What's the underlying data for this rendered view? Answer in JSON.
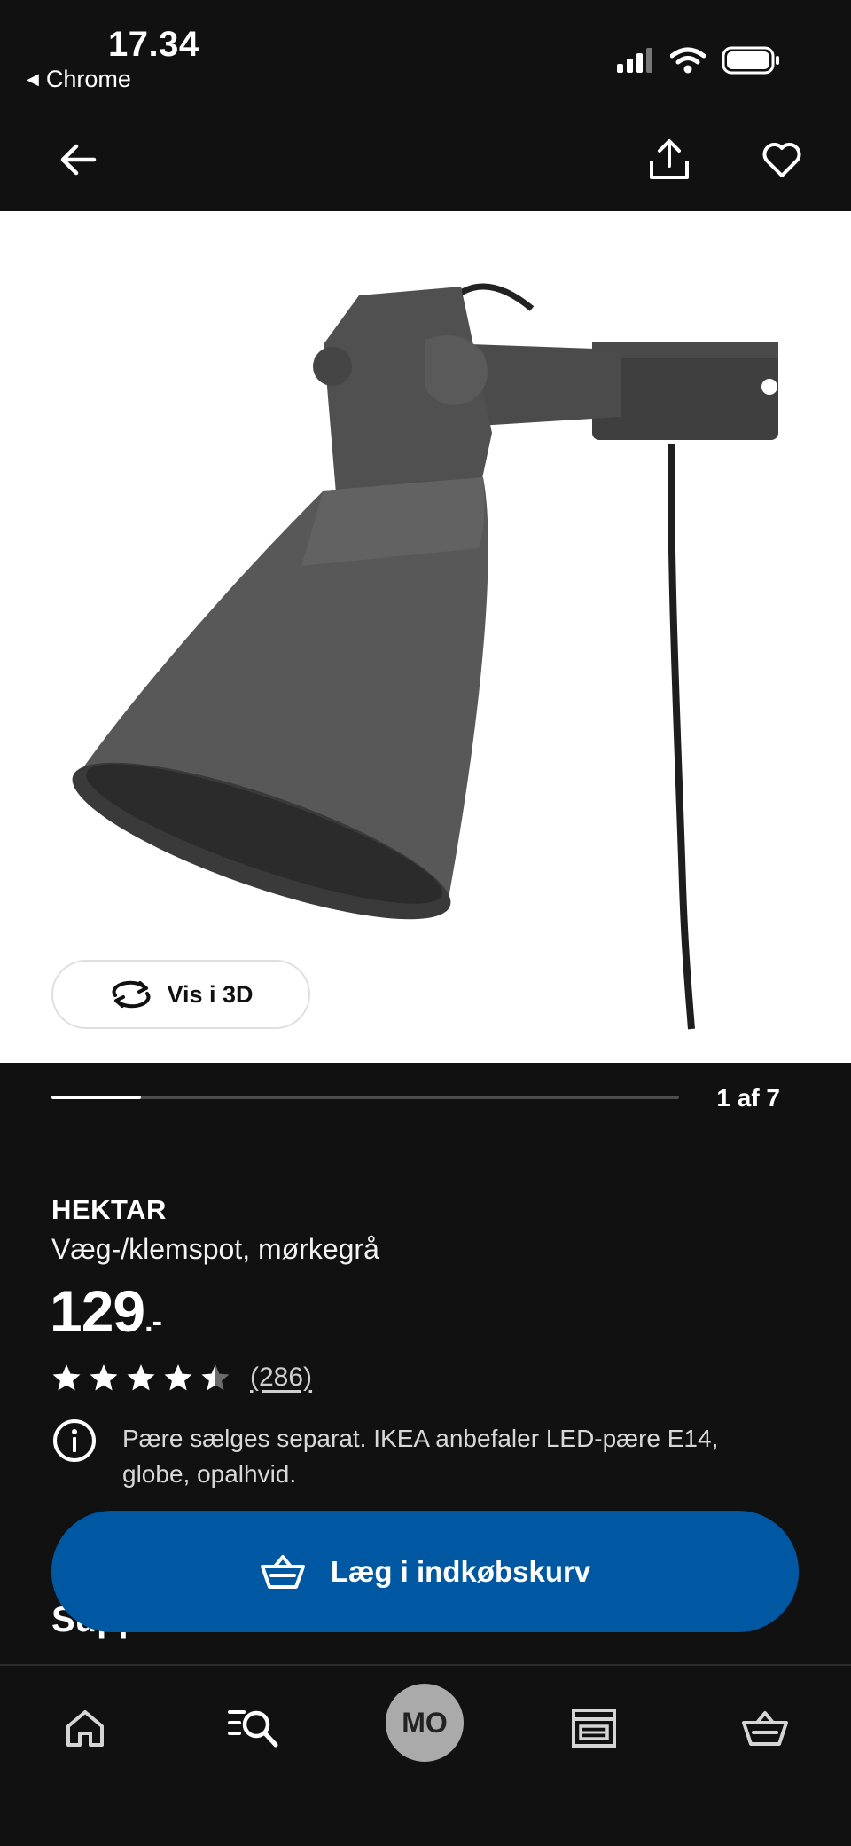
{
  "status_bar": {
    "time": "17.34",
    "back_app": "Chrome"
  },
  "icons": {
    "back": "arrow-left-icon",
    "share": "share-icon",
    "favorite": "heart-icon",
    "rotate": "rotate-3d-icon",
    "info": "info-icon",
    "basket": "basket-icon",
    "home": "home-icon",
    "search": "search-icon",
    "store": "store-icon"
  },
  "gallery": {
    "view_3d_label": "Vis i 3D",
    "page_counter": "1 af 7",
    "current_image": 1,
    "total_images": 7
  },
  "product": {
    "name": "HEKTAR",
    "description": "Væg-/klemspot, mørkegrå",
    "price": "129",
    "price_suffix": ".-",
    "rating": 4.5,
    "rating_count": "(286)",
    "info_text": "Pære sælges separat. IKEA anbefaler LED-pære E14, globe, opalhvid."
  },
  "section": {
    "supplement_heading": "Suppleret med"
  },
  "cart": {
    "button_label": "Læg i indkøbskurv",
    "color": "#0058a3"
  },
  "tabs": {
    "avatar_initials": "MO"
  }
}
